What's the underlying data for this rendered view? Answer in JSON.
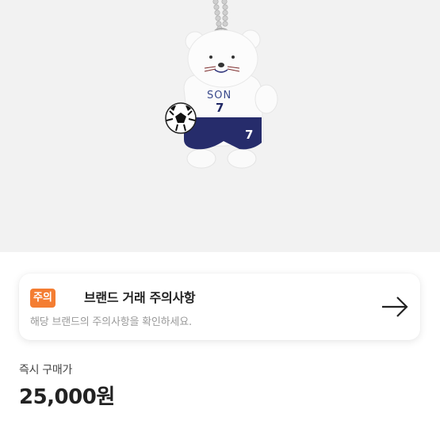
{
  "product": {
    "image_name": "bear-keyring-plush",
    "shirt_text": "SON",
    "shirt_number": "7",
    "shorts_number": "7"
  },
  "notice": {
    "badge": "주의",
    "title": "브랜드 거래 주의사항",
    "description": "해당 브랜드의 주의사항을 확인하세요.",
    "arrow_icon": "arrow-right-icon",
    "badge_color": "#f47d32"
  },
  "price": {
    "label": "즉시 구매가",
    "value": "25,000원"
  }
}
